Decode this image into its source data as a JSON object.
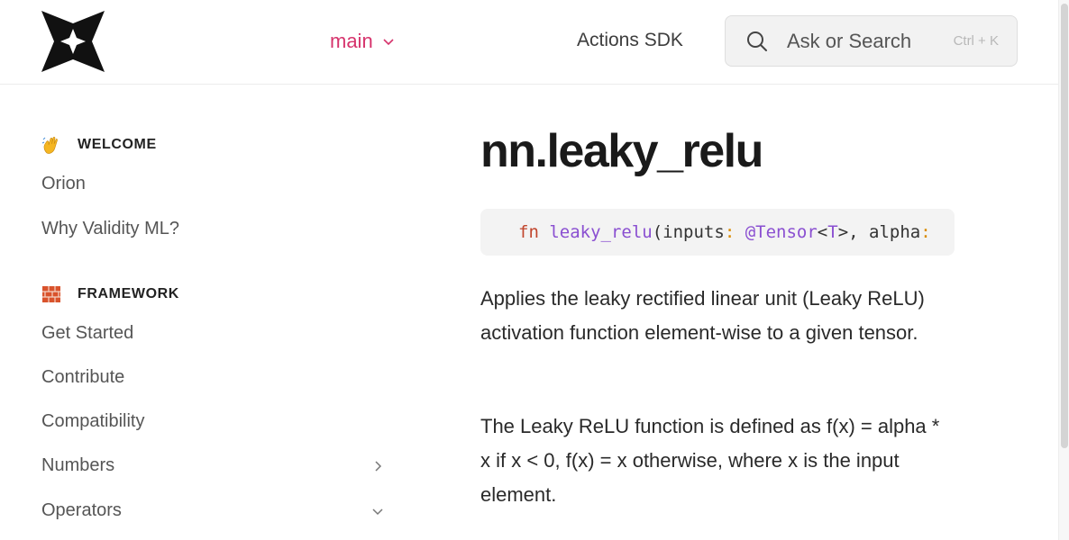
{
  "header": {
    "branch_label": "main",
    "nav_link": "Actions SDK",
    "search_placeholder": "Ask or Search",
    "search_shortcut": "Ctrl + K"
  },
  "sidebar": {
    "sections": [
      {
        "title": "WELCOME",
        "icon": "waving-hand-icon",
        "items": [
          "Orion",
          "Why Validity ML?"
        ]
      },
      {
        "title": "FRAMEWORK",
        "icon": "bricks-icon",
        "items": [
          "Get Started",
          "Contribute",
          "Compatibility",
          "Numbers",
          "Operators"
        ]
      }
    ]
  },
  "main": {
    "title": "nn.leaky_relu",
    "code": {
      "keyword": "fn",
      "function": "leaky_relu",
      "open_paren": "(inputs",
      "colon1": ":",
      "type1": "@Tensor",
      "lt": "<",
      "type_param": "T",
      "gt_comma": ">, alpha",
      "colon2": ":"
    },
    "paragraphs": [
      "Applies the leaky rectified linear unit (Leaky ReLU) activation function element-wise to a given tensor.",
      "The Leaky ReLU function is defined as f(x) = alpha * x if x < 0, f(x) = x otherwise, where x is the input element."
    ]
  },
  "colors": {
    "accent": "#d6336c",
    "code_keyword": "#c1462e",
    "code_function": "#8a4fd1",
    "code_punctuation": "#d98b00"
  }
}
